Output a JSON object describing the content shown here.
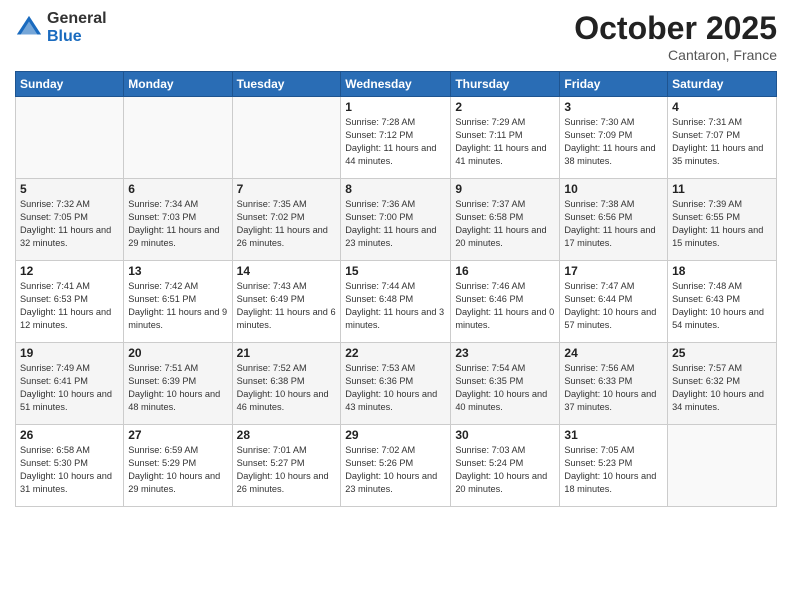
{
  "header": {
    "logo_general": "General",
    "logo_blue": "Blue",
    "month": "October 2025",
    "location": "Cantaron, France"
  },
  "weekdays": [
    "Sunday",
    "Monday",
    "Tuesday",
    "Wednesday",
    "Thursday",
    "Friday",
    "Saturday"
  ],
  "weeks": [
    [
      {
        "day": "",
        "info": ""
      },
      {
        "day": "",
        "info": ""
      },
      {
        "day": "",
        "info": ""
      },
      {
        "day": "1",
        "info": "Sunrise: 7:28 AM\nSunset: 7:12 PM\nDaylight: 11 hours\nand 44 minutes."
      },
      {
        "day": "2",
        "info": "Sunrise: 7:29 AM\nSunset: 7:11 PM\nDaylight: 11 hours\nand 41 minutes."
      },
      {
        "day": "3",
        "info": "Sunrise: 7:30 AM\nSunset: 7:09 PM\nDaylight: 11 hours\nand 38 minutes."
      },
      {
        "day": "4",
        "info": "Sunrise: 7:31 AM\nSunset: 7:07 PM\nDaylight: 11 hours\nand 35 minutes."
      }
    ],
    [
      {
        "day": "5",
        "info": "Sunrise: 7:32 AM\nSunset: 7:05 PM\nDaylight: 11 hours\nand 32 minutes."
      },
      {
        "day": "6",
        "info": "Sunrise: 7:34 AM\nSunset: 7:03 PM\nDaylight: 11 hours\nand 29 minutes."
      },
      {
        "day": "7",
        "info": "Sunrise: 7:35 AM\nSunset: 7:02 PM\nDaylight: 11 hours\nand 26 minutes."
      },
      {
        "day": "8",
        "info": "Sunrise: 7:36 AM\nSunset: 7:00 PM\nDaylight: 11 hours\nand 23 minutes."
      },
      {
        "day": "9",
        "info": "Sunrise: 7:37 AM\nSunset: 6:58 PM\nDaylight: 11 hours\nand 20 minutes."
      },
      {
        "day": "10",
        "info": "Sunrise: 7:38 AM\nSunset: 6:56 PM\nDaylight: 11 hours\nand 17 minutes."
      },
      {
        "day": "11",
        "info": "Sunrise: 7:39 AM\nSunset: 6:55 PM\nDaylight: 11 hours\nand 15 minutes."
      }
    ],
    [
      {
        "day": "12",
        "info": "Sunrise: 7:41 AM\nSunset: 6:53 PM\nDaylight: 11 hours\nand 12 minutes."
      },
      {
        "day": "13",
        "info": "Sunrise: 7:42 AM\nSunset: 6:51 PM\nDaylight: 11 hours\nand 9 minutes."
      },
      {
        "day": "14",
        "info": "Sunrise: 7:43 AM\nSunset: 6:49 PM\nDaylight: 11 hours\nand 6 minutes."
      },
      {
        "day": "15",
        "info": "Sunrise: 7:44 AM\nSunset: 6:48 PM\nDaylight: 11 hours\nand 3 minutes."
      },
      {
        "day": "16",
        "info": "Sunrise: 7:46 AM\nSunset: 6:46 PM\nDaylight: 11 hours\nand 0 minutes."
      },
      {
        "day": "17",
        "info": "Sunrise: 7:47 AM\nSunset: 6:44 PM\nDaylight: 10 hours\nand 57 minutes."
      },
      {
        "day": "18",
        "info": "Sunrise: 7:48 AM\nSunset: 6:43 PM\nDaylight: 10 hours\nand 54 minutes."
      }
    ],
    [
      {
        "day": "19",
        "info": "Sunrise: 7:49 AM\nSunset: 6:41 PM\nDaylight: 10 hours\nand 51 minutes."
      },
      {
        "day": "20",
        "info": "Sunrise: 7:51 AM\nSunset: 6:39 PM\nDaylight: 10 hours\nand 48 minutes."
      },
      {
        "day": "21",
        "info": "Sunrise: 7:52 AM\nSunset: 6:38 PM\nDaylight: 10 hours\nand 46 minutes."
      },
      {
        "day": "22",
        "info": "Sunrise: 7:53 AM\nSunset: 6:36 PM\nDaylight: 10 hours\nand 43 minutes."
      },
      {
        "day": "23",
        "info": "Sunrise: 7:54 AM\nSunset: 6:35 PM\nDaylight: 10 hours\nand 40 minutes."
      },
      {
        "day": "24",
        "info": "Sunrise: 7:56 AM\nSunset: 6:33 PM\nDaylight: 10 hours\nand 37 minutes."
      },
      {
        "day": "25",
        "info": "Sunrise: 7:57 AM\nSunset: 6:32 PM\nDaylight: 10 hours\nand 34 minutes."
      }
    ],
    [
      {
        "day": "26",
        "info": "Sunrise: 6:58 AM\nSunset: 5:30 PM\nDaylight: 10 hours\nand 31 minutes."
      },
      {
        "day": "27",
        "info": "Sunrise: 6:59 AM\nSunset: 5:29 PM\nDaylight: 10 hours\nand 29 minutes."
      },
      {
        "day": "28",
        "info": "Sunrise: 7:01 AM\nSunset: 5:27 PM\nDaylight: 10 hours\nand 26 minutes."
      },
      {
        "day": "29",
        "info": "Sunrise: 7:02 AM\nSunset: 5:26 PM\nDaylight: 10 hours\nand 23 minutes."
      },
      {
        "day": "30",
        "info": "Sunrise: 7:03 AM\nSunset: 5:24 PM\nDaylight: 10 hours\nand 20 minutes."
      },
      {
        "day": "31",
        "info": "Sunrise: 7:05 AM\nSunset: 5:23 PM\nDaylight: 10 hours\nand 18 minutes."
      },
      {
        "day": "",
        "info": ""
      }
    ]
  ]
}
